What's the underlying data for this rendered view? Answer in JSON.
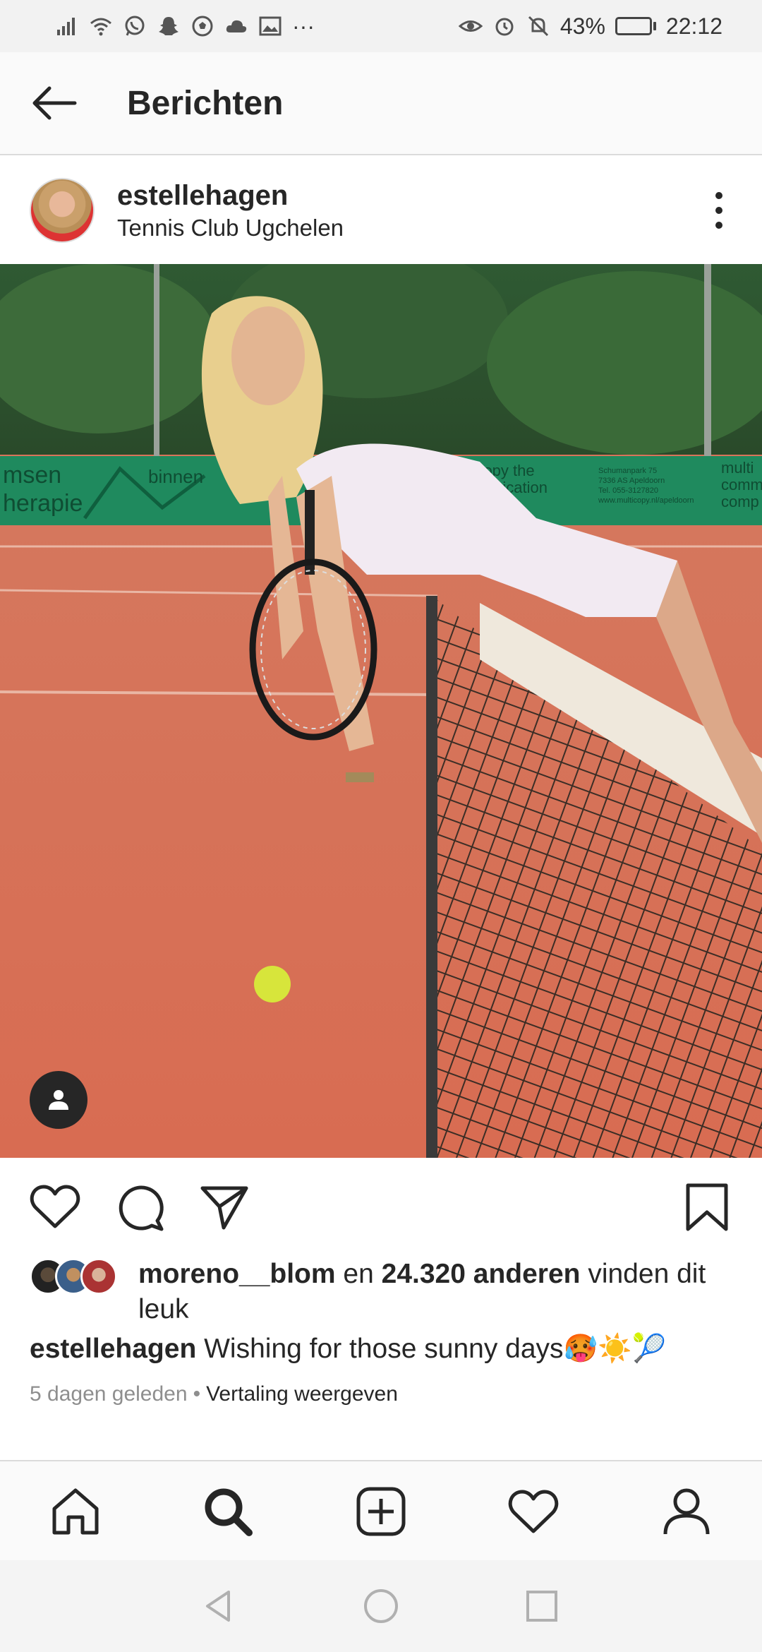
{
  "status_bar": {
    "battery": "43%",
    "time": "22:12",
    "left_icons": [
      "signal-icon",
      "wifi-icon",
      "whatsapp-icon",
      "snapchat-icon",
      "soccer-icon",
      "cloud-icon",
      "gallery-icon",
      "more-notifications-icon"
    ],
    "more": "···",
    "battery_level": 0.43
  },
  "header": {
    "title": "Berichten"
  },
  "post": {
    "username": "estellehagen",
    "location": "Tennis Club Ugchelen",
    "likes": {
      "first_liker": "moreno__blom",
      "connector": "en",
      "count_text": "24.320 anderen",
      "suffix": "vinden dit leuk"
    },
    "caption": {
      "username": "estellehagen",
      "text": "Wishing for those sunny days🥵☀️🎾"
    },
    "time_ago": "5 dagen geleden",
    "separator": "•",
    "translate": "Vertaling weergeven"
  },
  "photo": {
    "banners": {
      "left_top": "msen",
      "left_mid": "binnen",
      "left_bottom": "herapie",
      "middle_top": "multicopy the",
      "middle_mid": "communication",
      "address_1": "Schumanpark 75",
      "address_2": "7336 AS Apeldoorn",
      "address_3": "Tel. 055-3127820",
      "address_4": "www.multicopy.nl/apeldoorn",
      "right_top": "multi",
      "right_mid": "comm",
      "right_bottom": "comp"
    }
  },
  "colors": {
    "clay": "#d9745a",
    "banner_green": "#1f8a5e",
    "text": "#262626",
    "muted": "#8e8e8e"
  }
}
